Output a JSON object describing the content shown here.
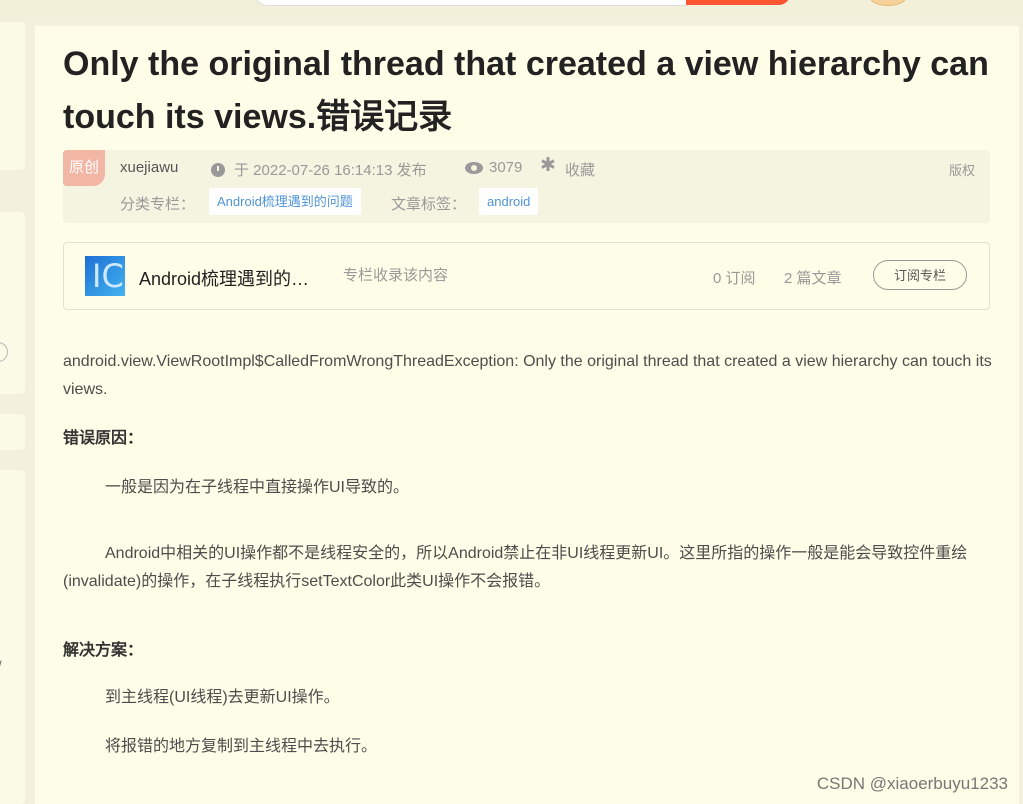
{
  "article": {
    "title": "Only the original thread that created a view hierarchy can touch its views.错误记录",
    "meta": {
      "original_badge": "原创",
      "author": "xuejiawu",
      "published": "于 2022-07-26 16:14:13 发布",
      "views": "3079",
      "favorite_label": "收藏",
      "copyright_label": "版权",
      "category_label": "分类专栏：",
      "category": "Android梳理遇到的问题",
      "tags_label": "文章标签：",
      "tag": "android"
    },
    "column": {
      "thumb_glyph": "IC",
      "name": "Android梳理遇到的问题",
      "description": "专栏收录该内容",
      "subscribers": "0 订阅",
      "articles": "2 篇文章",
      "subscribe_button": "订阅专栏"
    },
    "body": {
      "exception": "android.view.ViewRootImpl$CalledFromWrongThreadException: Only the original thread that created a view hierarchy can touch its views.",
      "cause_heading": "错误原因：",
      "cause_1": "一般是因为在子线程中直接操作UI导致的。",
      "cause_2": "Android中相关的UI操作都不是线程安全的，所以Android禁止在非UI线程更新UI。这里所指的操作一般是能会导致控件重绘(invalidate)的操作，在子线程执行setTextColor此类UI操作不会报错。",
      "solution_heading": "解决方案：",
      "solution_1": "到主线程(UI线程)去更新UI操作。",
      "solution_2": "将报错的地方复制到主线程中去执行。"
    }
  },
  "sidebar": {
    "glyph": "/"
  },
  "watermark": "CSDN @xiaoerbuyu1233",
  "colors": {
    "background": "#f3f1dd",
    "article_bg": "#fefde7",
    "badge": "#f2b6a4",
    "tag_text": "#5094d5",
    "search_button": "#fc5531"
  }
}
